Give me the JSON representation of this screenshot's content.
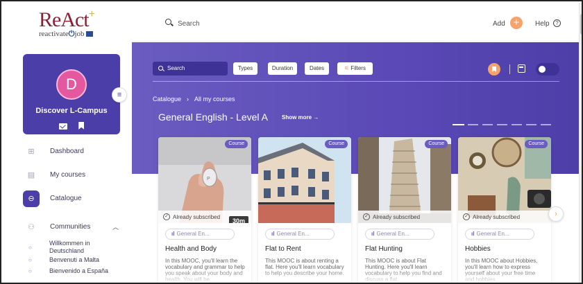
{
  "logo": {
    "main": "ReAct",
    "plus": "+",
    "sub_pre": "reactivate",
    "sub_job": "job"
  },
  "profile": {
    "initial": "D",
    "name": "Discover L-Campus"
  },
  "nav": {
    "items": [
      {
        "label": "Dashboard",
        "icon": "grid-icon"
      },
      {
        "label": "My courses",
        "icon": "book-icon"
      },
      {
        "label": "Catalogue",
        "icon": "catalogue-icon",
        "active": true
      },
      {
        "label": "Communities",
        "icon": "people-icon"
      }
    ],
    "communities": [
      {
        "label": "Willkommen in Deutschland"
      },
      {
        "label": "Benvenuti a Malta"
      },
      {
        "label": "Bienvenido a España"
      }
    ]
  },
  "topbar": {
    "search": "Search",
    "add": "Add",
    "help": "Help",
    "help_glyph": "?"
  },
  "filters": {
    "search": "Search",
    "chips": [
      "Types",
      "Duration",
      "Dates",
      "Filters"
    ]
  },
  "breadcrumb": {
    "first": "Catalogue",
    "separator": "›",
    "second": "All my courses"
  },
  "section": {
    "title": "General English - Level A",
    "show_more": "Show more →"
  },
  "cards": [
    {
      "badge": "Course",
      "subscribed": "Already subscribed",
      "duration": "30m",
      "level": "General En...",
      "title": "Health and Body",
      "desc": "In this MOOC, you'll learn the vocabulary and grammar to help you speak about your body and health. You will be"
    },
    {
      "badge": "Course",
      "subscribed": "",
      "duration": "",
      "level": "General En...",
      "title": "Flat to Rent",
      "desc": "This MOOC is about renting a flat. Here you'll learn vocabulary to help you describe your home."
    },
    {
      "badge": "Course",
      "subscribed": "Already subscribed",
      "duration": "",
      "level": "General En...",
      "title": "Flat Hunting",
      "desc": "This MOOC is about Flat Hunting. Here you'll learn vocabulary to help you find and discuss a flat."
    },
    {
      "badge": "Course",
      "subscribed": "Already subscribed",
      "duration": "",
      "level": "General En...",
      "title": "Hobbies",
      "desc": "In this MOOC about Hobbies, you'll learn how to express yourself about your free time and hobbies."
    }
  ],
  "colors": {
    "accent": "#4b3ea8",
    "orange": "#f5a36a",
    "brand": "#8b1f33"
  }
}
